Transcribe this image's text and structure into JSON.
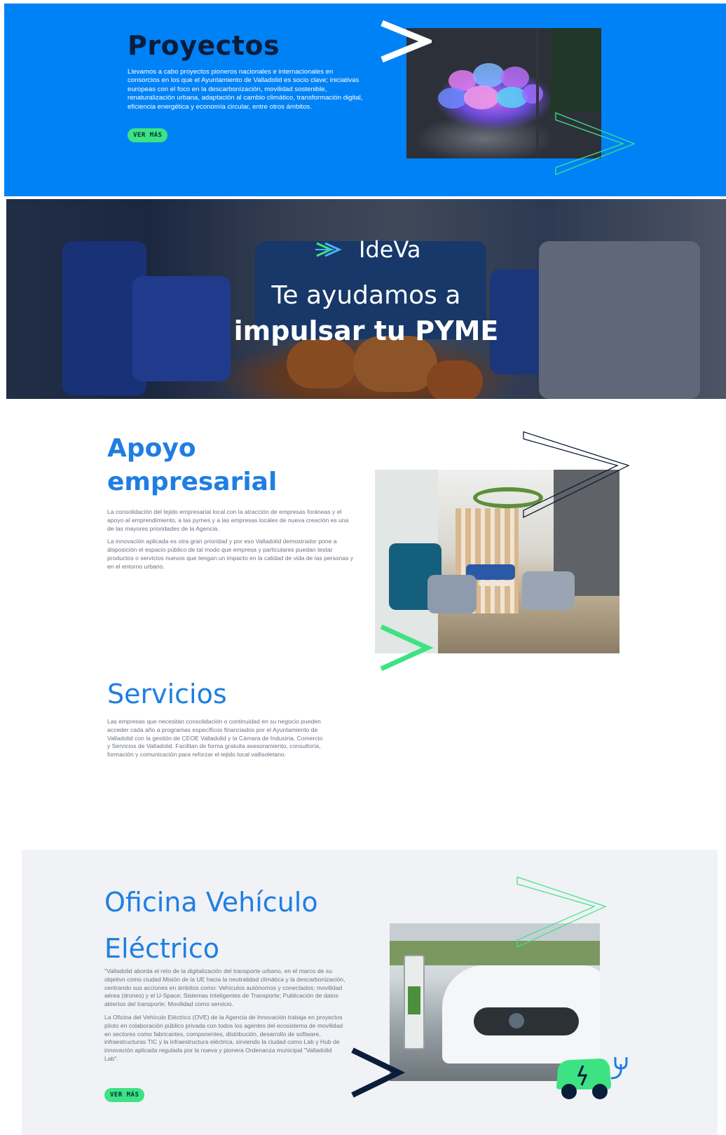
{
  "proyectos": {
    "title": "Proyectos",
    "description": "Llevamos a cabo proyectos pioneros nacionales e internacionales en consorcios en los que el Ayuntamiento de Valladolid es socio clave; iniciativas europeas con el foco en la descarbonización, movilidad sostenible, renaturalización urbana, adaptación al cambio climático, transformación digital, eficiencia energética y economía circular, entre otros ámbitos.",
    "button_label": "VER MÁS"
  },
  "hero": {
    "brand": "IdeVa",
    "line1": "Te ayudamos a",
    "line2": "impulsar tu PYME"
  },
  "apoyo": {
    "title_line1": "Apoyo",
    "title_line2": "empresarial",
    "paragraph1": "La consolidación del tejido empresarial local con la atracción de empresas foráneas y el apoyo al emprendimiento, a las pymes y a las empresas locales de nueva creación es una de las mayores prioridades de la Agencia.",
    "paragraph2": "La innovación aplicada es otra gran prioridad y por eso Valladolid demostrador pone a disposición el espacio público de tal modo que empresa y particulares puedan testar productos o servicios nuevos que tengan un impacto en la calidad de vida de las personas y en el entorno urbano."
  },
  "servicios": {
    "title": "Servicios",
    "paragraph": "Las empresas que necesitan consolidación o continuidad en su negocio pueden acceder cada año a programas específicos financiados por el Ayuntamiento de Valladolid con la gestión de CEOE Valladolid y la Cámara de Industria, Comercio y Servicios de Valladolid. Facilitan de forma gratuita asesoramiento, consultoría, formación y comunicación para reforzar el tejido local vallisoletano."
  },
  "ove": {
    "title_line1": "Oficina Vehículo",
    "title_line2": "Eléctrico",
    "paragraph1": "\"Valladolid aborda el reto de la digitalización del transporte urbano, en el marco de su objetivo como ciudad Misión de la UE hacia la neutralidad climática y la descarbonización, centrando sus acciones en ámbitos como: Vehículos autónomos y conectados; movilidad aérea (drones) y el U-Space; Sistemas Inteligentes de Transporte; Publicación de datos abiertos del transporte; Movilidad como servicio.",
    "paragraph2": "La Oficina del Vehículo Eléctrico (OVE) de la Agencia de Innovación trabaja en proyectos piloto en colaboración público privada con todos los agentes del ecosistema de movilidad en sectores como fabricantes, componentes, distribución, desarrollo de software, infraestructuras TIC y la infraestructura eléctrica, sirviendo la ciudad como Lab y Hub de innovación aplicada regulada por la nueva y pionera Ordenanza municipal \"Valladolid Lab\".",
    "button_label": "VER MÁS"
  },
  "colors": {
    "proyectos_bg": "#0082f7",
    "accent_green": "#3de383",
    "title_blue": "#1e7ee3",
    "navy": "#0b1d3a",
    "ove_bg": "#f0f2f5"
  },
  "icons": [
    "chevron-white-icon",
    "chevron-green-outline-icon",
    "ideva-logo-icon",
    "chevron-navy-outline-icon",
    "chevron-green-icon",
    "chevron-navy-icon",
    "electric-car-icon"
  ]
}
